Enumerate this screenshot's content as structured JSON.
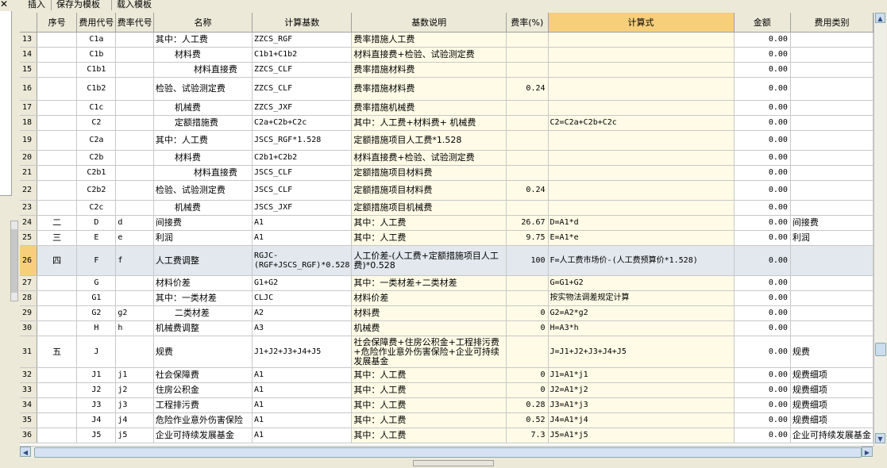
{
  "close_glyph": "✕",
  "toolbar": {
    "insert": "插入",
    "save_template": "保存为模板",
    "load_template": "载入模板"
  },
  "columns": [
    "序号",
    "费用代号",
    "费率代号",
    "名称",
    "计算基数",
    "基数说明",
    "费率(%)",
    "计算式",
    "金额",
    "费用类别"
  ],
  "rows": [
    {
      "n": "13",
      "xh": "",
      "code": "C1a",
      "rate_code": "",
      "name": "其中：人工费",
      "base": "ZZCS_RGF",
      "desc": "费率措施人工费",
      "rate": "",
      "formula": "",
      "amount": "0.00",
      "cat": ""
    },
    {
      "n": "14",
      "xh": "",
      "code": "C1b",
      "rate_code": "",
      "name": "材料费",
      "base": "C1b1+C1b2",
      "desc": "材料直接费+检验、试验测定费",
      "rate": "",
      "formula": "",
      "amount": "0.00",
      "cat": ""
    },
    {
      "n": "15",
      "xh": "",
      "code": "C1b1",
      "rate_code": "",
      "name": "材料直接费",
      "base": "ZZCS_CLF",
      "desc": "费率措施材料费",
      "rate": "",
      "formula": "",
      "amount": "0.00",
      "cat": ""
    },
    {
      "n": "16",
      "xh": "",
      "code": "C1b2",
      "rate_code": "",
      "name": "检验、试验测定费",
      "base": "ZZCS_CLF",
      "desc": "费率措施材料费",
      "rate": "0.24",
      "formula": "",
      "amount": "0.00",
      "cat": ""
    },
    {
      "n": "17",
      "xh": "",
      "code": "C1c",
      "rate_code": "",
      "name": "机械费",
      "base": "ZZCS_JXF",
      "desc": "费率措施机械费",
      "rate": "",
      "formula": "",
      "amount": "0.00",
      "cat": ""
    },
    {
      "n": "18",
      "xh": "",
      "code": "C2",
      "rate_code": "",
      "name": "定额措施费",
      "base": "C2a+C2b+C2c",
      "desc": "其中：人工费+材料费+        机械费",
      "rate": "",
      "formula": "C2=C2a+C2b+C2c",
      "amount": "0.00",
      "cat": ""
    },
    {
      "n": "19",
      "xh": "",
      "code": "C2a",
      "rate_code": "",
      "name": "其中：人工费",
      "base": "JSCS_RGF*1.528",
      "desc": "定额措施项目人工费*1.528",
      "rate": "",
      "formula": "",
      "amount": "0.00",
      "cat": ""
    },
    {
      "n": "20",
      "xh": "",
      "code": "C2b",
      "rate_code": "",
      "name": "材料费",
      "base": "C2b1+C2b2",
      "desc": "材料直接费+检验、试验测定费",
      "rate": "",
      "formula": "",
      "amount": "0.00",
      "cat": ""
    },
    {
      "n": "21",
      "xh": "",
      "code": "C2b1",
      "rate_code": "",
      "name": "材料直接费",
      "base": "JSCS_CLF",
      "desc": "定额措施项目材料费",
      "rate": "",
      "formula": "",
      "amount": "0.00",
      "cat": ""
    },
    {
      "n": "22",
      "xh": "",
      "code": "C2b2",
      "rate_code": "",
      "name": "检验、试验测定费",
      "base": "JSCS_CLF",
      "desc": "定额措施项目材料费",
      "rate": "0.24",
      "formula": "",
      "amount": "0.00",
      "cat": ""
    },
    {
      "n": "23",
      "xh": "",
      "code": "C2c",
      "rate_code": "",
      "name": "机械费",
      "base": "JSCS_JXF",
      "desc": "定额措施项目机械费",
      "rate": "",
      "formula": "",
      "amount": "0.00",
      "cat": ""
    },
    {
      "n": "24",
      "xh": "二",
      "code": "D",
      "rate_code": "d",
      "name": "间接费",
      "base": "A1",
      "desc": "其中：人工费",
      "rate": "26.67",
      "formula": "D=A1*d",
      "amount": "0.00",
      "cat": "间接费"
    },
    {
      "n": "25",
      "xh": "三",
      "code": "E",
      "rate_code": "e",
      "name": "利润",
      "base": "A1",
      "desc": "其中：人工费",
      "rate": "9.75",
      "formula": "E=A1*e",
      "amount": "0.00",
      "cat": "利润"
    },
    {
      "n": "26",
      "xh": "四",
      "code": "F",
      "rate_code": "f",
      "name": "人工费调整",
      "base": "RGJC-(RGF+JSCS_RGF)*0.528",
      "desc": "人工价差-(人工费+定额措施项目人工费)*0.528",
      "rate": "100",
      "formula": "F=人工费市场价-(人工费预算价*1.528)",
      "amount": "0.00",
      "cat": ""
    },
    {
      "n": "27",
      "xh": "",
      "code": "G",
      "rate_code": "",
      "name": "材料价差",
      "base": "G1+G2",
      "desc": "其中：一类材差+二类材差",
      "rate": "",
      "formula": "G=G1+G2",
      "amount": "0.00",
      "cat": ""
    },
    {
      "n": "28",
      "xh": "",
      "code": "G1",
      "rate_code": "",
      "name": "其中：一类材差",
      "base": "CLJC",
      "desc": "材料价差",
      "rate": "",
      "formula": "按实物法调差规定计算",
      "amount": "0.00",
      "cat": ""
    },
    {
      "n": "29",
      "xh": "",
      "code": "G2",
      "rate_code": "g2",
      "name": "二类材差",
      "base": "A2",
      "desc": "材料费",
      "rate": "0",
      "formula": "G2=A2*g2",
      "amount": "0.00",
      "cat": ""
    },
    {
      "n": "30",
      "xh": "",
      "code": "H",
      "rate_code": "h",
      "name": "机械费调整",
      "base": "A3",
      "desc": "机械费",
      "rate": "0",
      "formula": "H=A3*h",
      "amount": "0.00",
      "cat": ""
    },
    {
      "n": "31",
      "xh": "五",
      "code": "J",
      "rate_code": "",
      "name": "规费",
      "base": "J1+J2+J3+J4+J5",
      "desc": "社会保障费+住房公积金+工程排污费+危险作业意外伤害保险+企业可持续发展基金",
      "rate": "",
      "formula": "J=J1+J2+J3+J4+J5",
      "amount": "0.00",
      "cat": "规费"
    },
    {
      "n": "32",
      "xh": "",
      "code": "J1",
      "rate_code": "j1",
      "name": "社会保障费",
      "base": "A1",
      "desc": "其中：人工费",
      "rate": "0",
      "formula": "J1=A1*j1",
      "amount": "0.00",
      "cat": "规费细项"
    },
    {
      "n": "33",
      "xh": "",
      "code": "J2",
      "rate_code": "j2",
      "name": "住房公积金",
      "base": "A1",
      "desc": "其中：人工费",
      "rate": "0",
      "formula": "J2=A1*j2",
      "amount": "0.00",
      "cat": "规费细项"
    },
    {
      "n": "34",
      "xh": "",
      "code": "J3",
      "rate_code": "j3",
      "name": "工程排污费",
      "base": "A1",
      "desc": "其中：人工费",
      "rate": "0.28",
      "formula": "J3=A1*j3",
      "amount": "0.00",
      "cat": "规费细项"
    },
    {
      "n": "35",
      "xh": "",
      "code": "J4",
      "rate_code": "j4",
      "name": "危险作业意外伤害保险",
      "base": "A1",
      "desc": "其中：人工费",
      "rate": "0.52",
      "formula": "J4=A1*j4",
      "amount": "0.00",
      "cat": "规费细项"
    },
    {
      "n": "36",
      "xh": "",
      "code": "J5",
      "rate_code": "j5",
      "name": "企业可持续发展基金",
      "base": "A1",
      "desc": "其中：人工费",
      "rate": "7.3",
      "formula": "J5=A1*j5",
      "amount": "0.00",
      "cat": "企业可持续发展基金"
    }
  ],
  "arrows": {
    "up": "▲",
    "down": "▼",
    "left": "◀",
    "right": "▶"
  }
}
